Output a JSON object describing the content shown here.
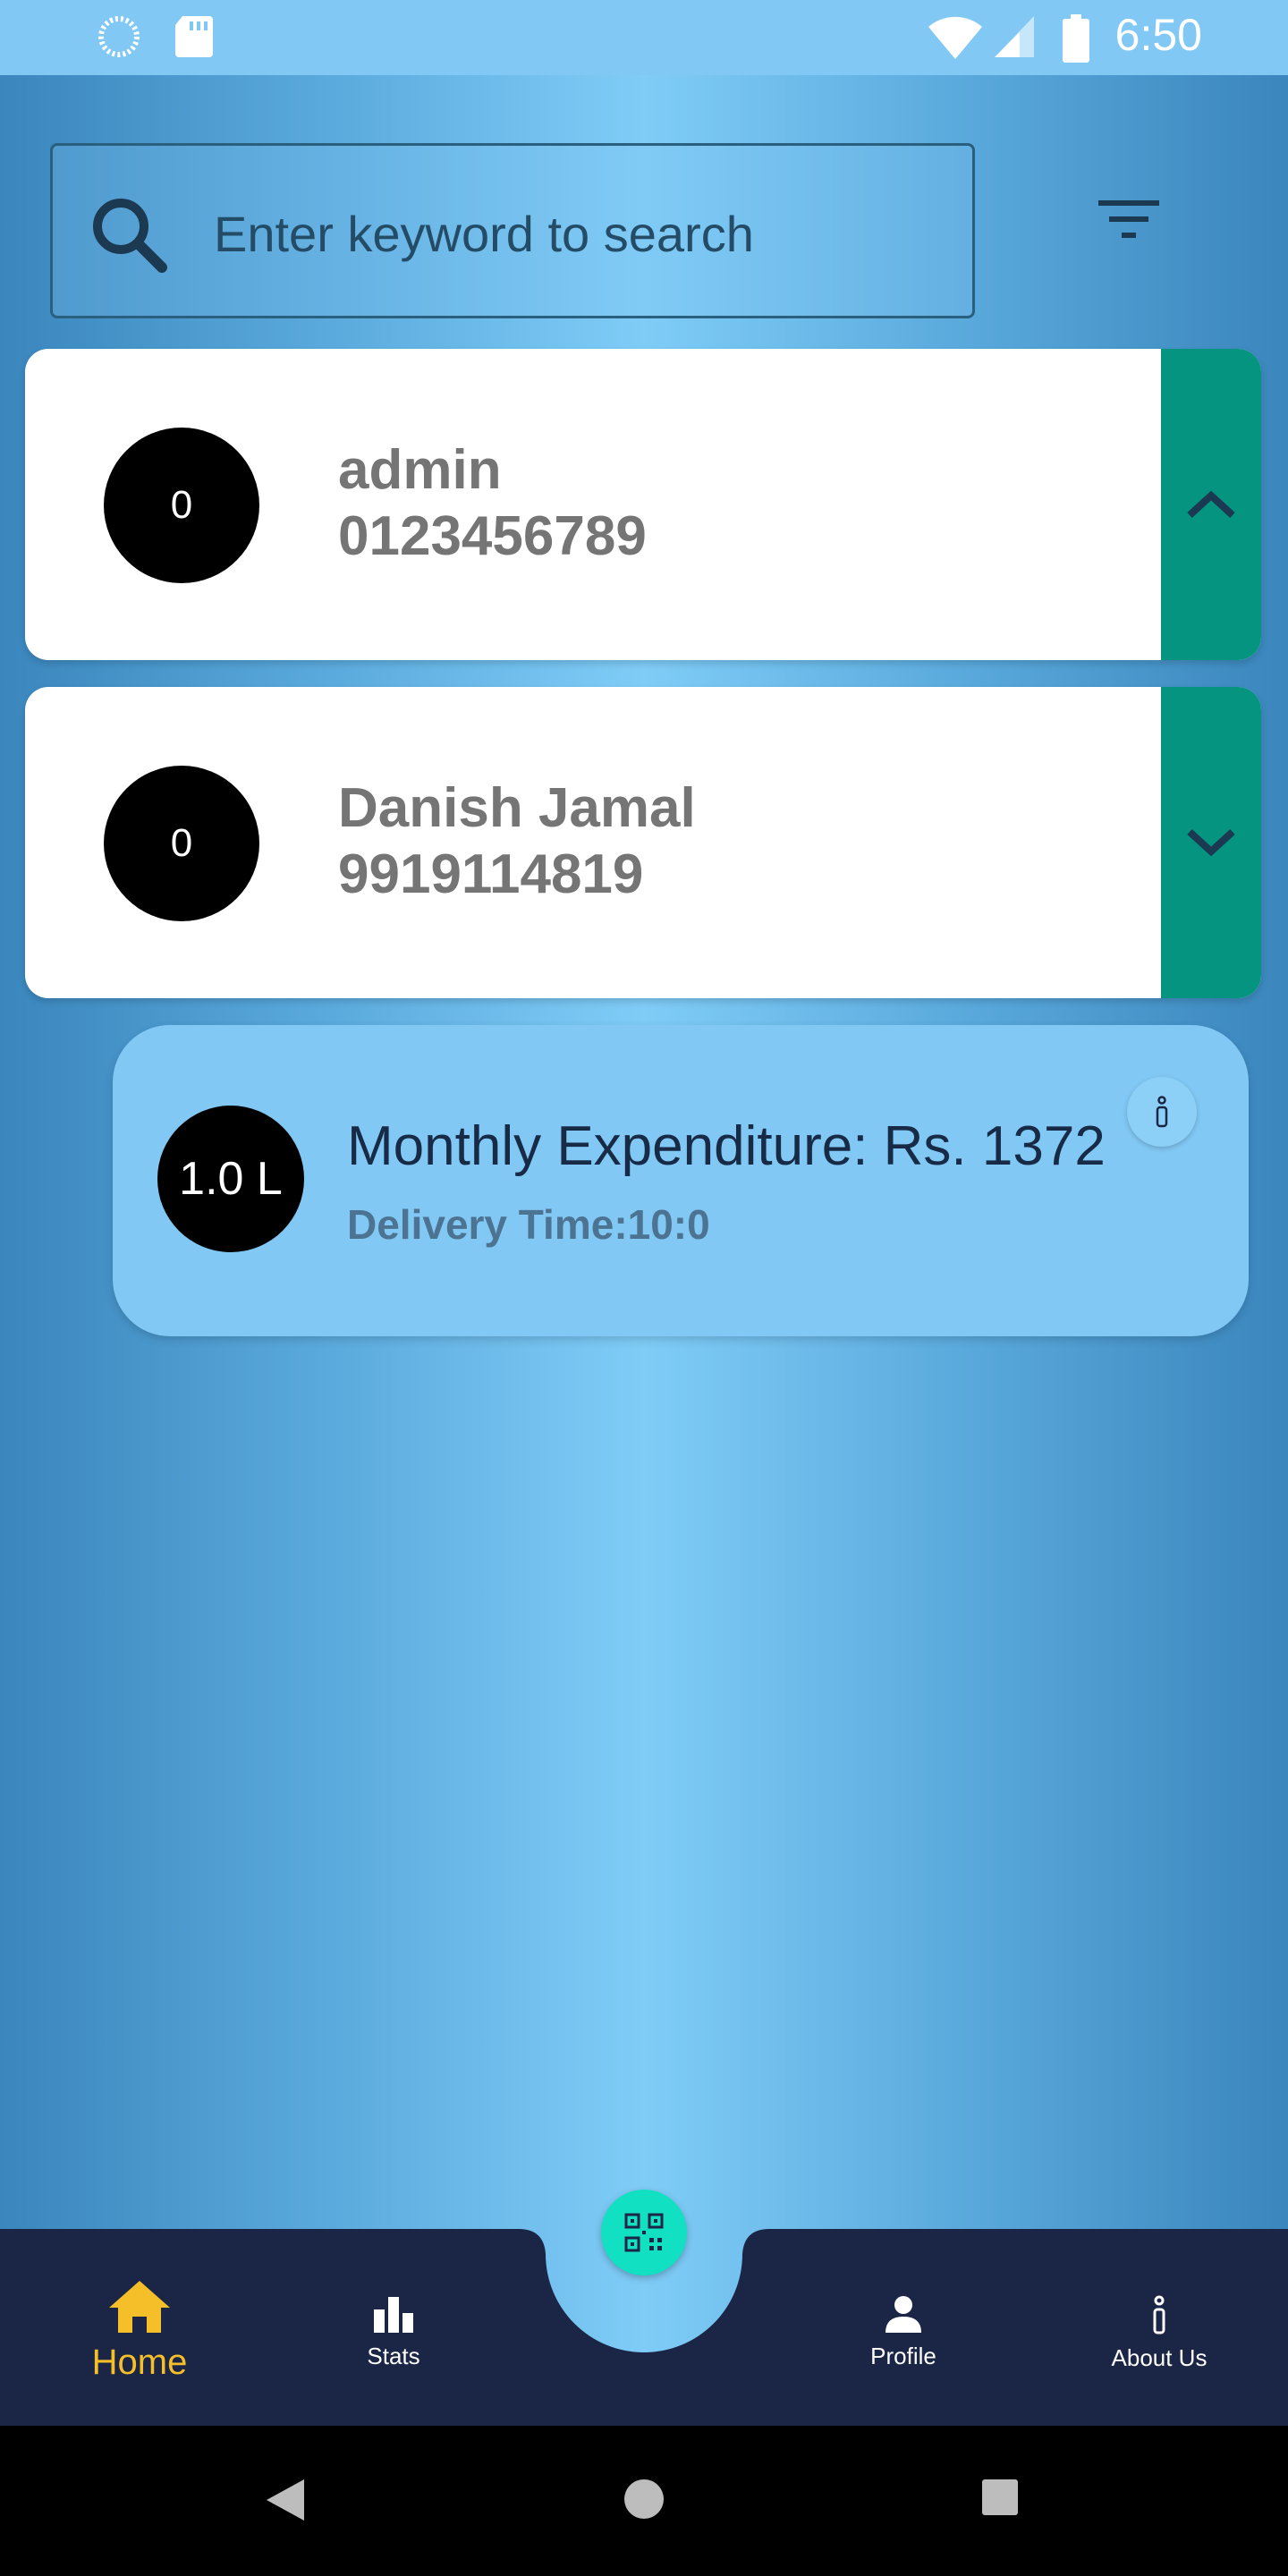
{
  "status_bar": {
    "time": "6:50"
  },
  "search": {
    "placeholder": "Enter keyword to search"
  },
  "cards": [
    {
      "badge": "0",
      "name": "admin",
      "phone": "0123456789",
      "expanded": true
    },
    {
      "badge": "0",
      "name": "Danish Jamal",
      "phone": "9919114819",
      "expanded": false
    }
  ],
  "detail": {
    "quantity": "1.0 L",
    "expenditure": "Monthly Expenditure: Rs. 1372",
    "delivery_time": "Delivery Time:10:0"
  },
  "nav": {
    "home": "Home",
    "stats": "Stats",
    "profile": "Profile",
    "about": "About Us"
  },
  "colors": {
    "accent_teal": "#059480",
    "nav_bg": "#1b2545",
    "active_nav": "#f5bf2a",
    "fab": "#11e0c2"
  }
}
